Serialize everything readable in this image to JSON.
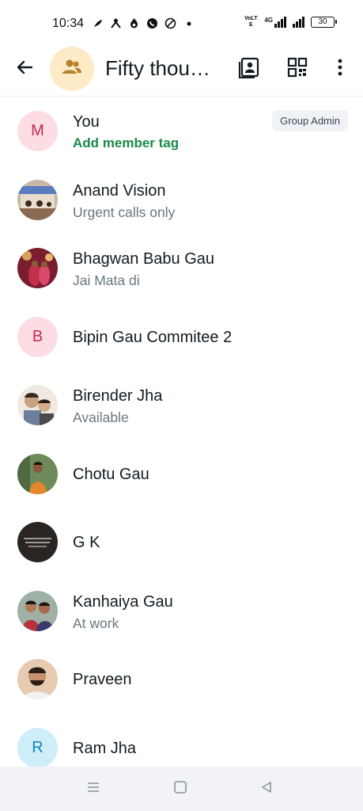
{
  "status_bar": {
    "time": "10:34",
    "left_icons": [
      "feather-icon",
      "network-icon",
      "flame-icon",
      "whatsapp-icon",
      "vpn-icon",
      "dot-icon"
    ],
    "volte_label": "VoLTE",
    "network": "4G",
    "battery": "30"
  },
  "app_bar": {
    "group_title": "Fifty thou…",
    "icons": [
      "back-arrow-icon",
      "group-icon",
      "contacts-icon",
      "qr-code-icon",
      "more-vert-icon"
    ]
  },
  "members": [
    {
      "name": "You",
      "subtitle": "Add member tag",
      "avatar_letter": "M",
      "badge": "Group Admin"
    },
    {
      "name": "Anand Vision",
      "subtitle": "Urgent calls only"
    },
    {
      "name": "Bhagwan Babu Gau",
      "subtitle": "Jai Mata di"
    },
    {
      "name": "Bipin Gau Commitee 2",
      "avatar_letter": "B"
    },
    {
      "name": "Birender Jha",
      "subtitle": "Available"
    },
    {
      "name": "Chotu Gau"
    },
    {
      "name": "G K"
    },
    {
      "name": "Kanhaiya Gau",
      "subtitle": "At work"
    },
    {
      "name": "Praveen"
    },
    {
      "name": "Ram Jha",
      "avatar_letter": "R"
    }
  ],
  "colors": {
    "accent_green": "#1a8a46",
    "group_avatar_bg": "#fdebc8",
    "group_avatar_fg": "#b5822a",
    "letter_pink_bg": "#fcdde4",
    "letter_pink_fg": "#c22a58",
    "letter_blue_bg": "#cfeefa",
    "letter_blue_fg": "#0b86b8"
  },
  "nav_bar": {
    "icons": [
      "menu-icon",
      "home-square-icon",
      "back-triangle-icon"
    ]
  }
}
